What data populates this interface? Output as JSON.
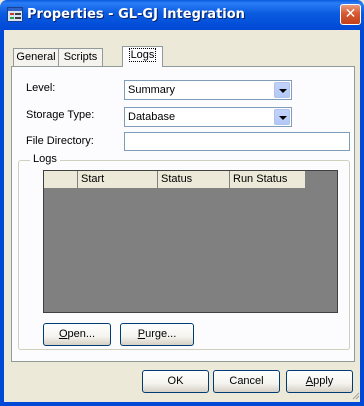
{
  "window": {
    "title": "Properties - GL-GJ Integration",
    "close_glyph": "✕",
    "icon": "properties-window-icon"
  },
  "tabs": [
    {
      "label": "General",
      "active": false
    },
    {
      "label": "Scripts",
      "active": false
    },
    {
      "label": "Logs",
      "active": true
    }
  ],
  "form": {
    "level_label": "Level:",
    "level_value": "Summary",
    "storage_label": "Storage Type:",
    "storage_value": "Database",
    "directory_label": "File Directory:",
    "directory_value": ""
  },
  "logs": {
    "group_label": "Logs",
    "columns": [
      "",
      "Start",
      "Status",
      "Run Status"
    ],
    "open_first": "O",
    "open_rest": "pen...",
    "purge_first": "P",
    "purge_rest": "urge..."
  },
  "footer": {
    "ok": "OK",
    "cancel": "Cancel",
    "apply_first": "A",
    "apply_rest": "pply"
  },
  "colors": {
    "titlebar": "#0a5be0",
    "dialog_bg": "#ece9d8",
    "grid_bg": "#808080"
  }
}
